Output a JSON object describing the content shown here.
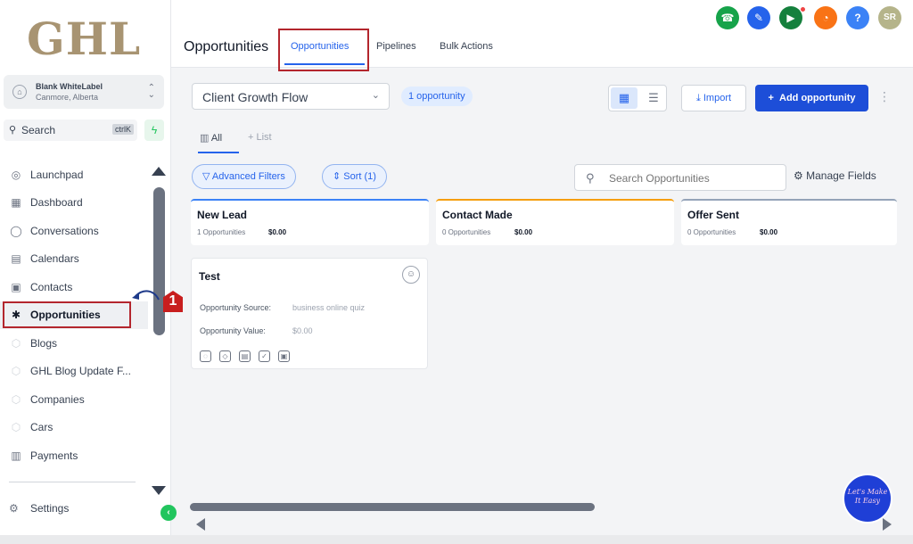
{
  "sidebar": {
    "logo": "GHL",
    "account": {
      "name": "Blank WhiteLabel",
      "location": "Canmore, Alberta"
    },
    "search": {
      "label": "Search",
      "shortcut": "ctrlK"
    },
    "items": [
      {
        "label": "Launchpad",
        "icon": "rocket-icon"
      },
      {
        "label": "Dashboard",
        "icon": "dashboard-icon"
      },
      {
        "label": "Conversations",
        "icon": "chat-icon"
      },
      {
        "label": "Calendars",
        "icon": "calendar-icon"
      },
      {
        "label": "Contacts",
        "icon": "contacts-icon"
      },
      {
        "label": "Opportunities",
        "icon": "opportunities-icon"
      },
      {
        "label": "Blogs",
        "icon": "box-icon"
      },
      {
        "label": "GHL Blog Update F...",
        "icon": "box-icon"
      },
      {
        "label": "Companies",
        "icon": "box-icon"
      },
      {
        "label": "Cars",
        "icon": "box-icon"
      },
      {
        "label": "Payments",
        "icon": "payments-icon"
      }
    ],
    "settings": "Settings",
    "annotation": "1"
  },
  "topbar": {
    "title": "Opportunities",
    "tabs": [
      "Opportunities",
      "Pipelines",
      "Bulk Actions"
    ],
    "icons": [
      {
        "name": "phone-icon",
        "color": "#16a34a",
        "glyph": "☎"
      },
      {
        "name": "pin-icon",
        "color": "#2563eb",
        "glyph": "✎"
      },
      {
        "name": "megaphone-icon",
        "color": "#15803d",
        "glyph": "▶"
      },
      {
        "name": "bell-icon",
        "color": "#f97316",
        "glyph": "◔"
      },
      {
        "name": "help-icon",
        "color": "#3b82f6",
        "glyph": "?"
      },
      {
        "name": "avatar",
        "color": "#b5b48a",
        "glyph": "SR"
      }
    ]
  },
  "toolbar": {
    "pipeline": "Client Growth Flow",
    "count": "1 opportunity",
    "import_label": "Import",
    "add_label": "Add opportunity"
  },
  "subtabs": {
    "all": "All",
    "list": "List"
  },
  "filters": {
    "advanced": "Advanced Filters",
    "sort": "Sort (1)",
    "search_placeholder": "Search Opportunities",
    "manage_fields": "Manage Fields"
  },
  "stages": [
    {
      "name": "New Lead",
      "count": "1 Opportunities",
      "value": "$0.00",
      "color": "#3b82f6"
    },
    {
      "name": "Contact Made",
      "count": "0 Opportunities",
      "value": "$0.00",
      "color": "#f59e0b"
    },
    {
      "name": "Offer Sent",
      "count": "0 Opportunities",
      "value": "$0.00",
      "color": "#94a3b8"
    }
  ],
  "card": {
    "title": "Test",
    "source_label": "Opportunity Source:",
    "source_value": "business online quiz",
    "value_label": "Opportunity Value:",
    "value_value": "$0.00"
  },
  "chat_widget": "Let's Make It Easy"
}
